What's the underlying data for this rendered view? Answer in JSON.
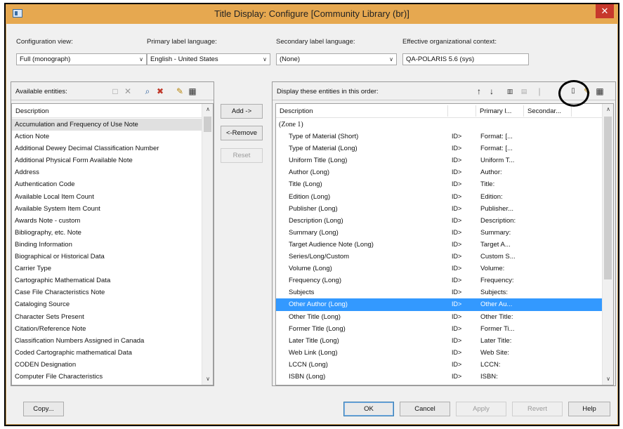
{
  "window": {
    "title": "Title Display: Configure [Community Library  (br)]",
    "close_glyph": "✕"
  },
  "config": {
    "configuration_view_label": "Configuration view:",
    "configuration_view_value": "Full (monograph)",
    "primary_label_language_label": "Primary label language:",
    "primary_label_language_value": "English - United States",
    "secondary_label_language_label": "Secondary label language:",
    "secondary_label_language_value": "(None)",
    "effective_context_label": "Effective organizational context:",
    "effective_context_value": "QA-POLARIS 5.6 (sys)"
  },
  "available": {
    "caption": "Available entities:",
    "column_header": "Description",
    "items": [
      "Accumulation and Frequency of Use Note",
      "Action Note",
      "Additional Dewey Decimal Classification Number",
      "Additional Physical Form Available Note",
      "Address",
      "Authentication Code",
      "Available Local Item Count",
      "Available System Item Count",
      "Awards Note - custom",
      "Bibliography, etc. Note",
      "Binding Information",
      "Biographical or Historical Data",
      "Carrier Type",
      "Cartographic Mathematical Data",
      "Case File Characteristics Note",
      "Cataloging Source",
      "Character Sets Present",
      "Citation/Reference Note",
      "Classification Numbers Assigned in Canada",
      "Coded Cartographic mathematical Data",
      "CODEN Designation",
      "Computer File Characteristics"
    ]
  },
  "middle_buttons": {
    "add": "Add ->",
    "remove": "<-Remove",
    "reset": "Reset"
  },
  "display": {
    "caption": "Display these entities in this order:",
    "col_description": "Description",
    "col_primary": "Primary l...",
    "col_secondary": "Secondar...",
    "zone_label": "(Zone 1)",
    "rows": [
      {
        "description": "Type of Material (Short)",
        "primary": "Format: [..."
      },
      {
        "description": "Type of Material (Long)",
        "primary": "Format: [..."
      },
      {
        "description": "Uniform Title (Long)",
        "primary": "Uniform T..."
      },
      {
        "description": "Author (Long)",
        "primary": "Author:"
      },
      {
        "description": "Title (Long)",
        "primary": "Title:"
      },
      {
        "description": "Edition (Long)",
        "primary": "Edition:"
      },
      {
        "description": "Publisher (Long)",
        "primary": "Publisher..."
      },
      {
        "description": "Description (Long)",
        "primary": "Description:"
      },
      {
        "description": "Summary (Long)",
        "primary": "Summary:"
      },
      {
        "description": "Target Audience Note (Long)",
        "primary": "Target A..."
      },
      {
        "description": "Series/Long/Custom",
        "primary": "Custom S..."
      },
      {
        "description": "Volume (Long)",
        "primary": "Volume:"
      },
      {
        "description": "Frequency (Long)",
        "primary": "Frequency:"
      },
      {
        "description": "Subjects",
        "primary": "Subjects:"
      },
      {
        "description": "Other Author (Long)",
        "primary": "Other Au..."
      },
      {
        "description": "Other Title (Long)",
        "primary": "Other Title:"
      },
      {
        "description": "Former Title (Long)",
        "primary": "Former Ti..."
      },
      {
        "description": "Later Title (Long)",
        "primary": "Later Title:"
      },
      {
        "description": "Web Link (Long)",
        "primary": "Web Site:"
      },
      {
        "description": "LCCN (Long)",
        "primary": "LCCN:"
      },
      {
        "description": "ISBN (Long)",
        "primary": "ISBN:"
      }
    ],
    "row_glyph": "ID>"
  },
  "footer": {
    "copy": "Copy...",
    "ok": "OK",
    "cancel": "Cancel",
    "apply": "Apply",
    "revert": "Revert",
    "help": "Help"
  }
}
